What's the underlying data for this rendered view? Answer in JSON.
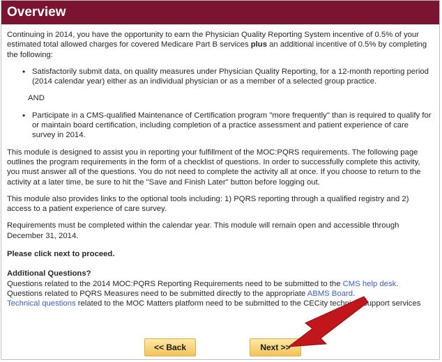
{
  "header": {
    "title": "Overview"
  },
  "content": {
    "intro_pre": "Continuing in 2014, you have the opportunity to earn the Physician Quality Reporting System incentive of 0.5% of your estimated total allowed charges for covered Medicare Part B services ",
    "intro_bold": "plus",
    "intro_post": " an additional incentive of 0.5% by completing the following:",
    "bullet1": "Satisfactorily submit data, on quality measures under Physician Quality Reporting, for a 12-month reporting period (2014 calendar year) either as an individual physician or as a member of a selected group practice.",
    "and_text": "AND",
    "bullet2": "Participate in a CMS-qualified Maintenance of Certification program \"more frequently\" than is required to qualify for or maintain board certification, including completion of a practice assessment and patient experience of care survey in 2014.",
    "para1": "This module is designed to assist you in reporting your fulfillment of the MOC:PQRS requirements. The following page outlines the program requirements in the form of a checklist of questions. In order to successfully complete this activity, you must answer all of the questions. You do not need to complete the activity all at once. If you choose to return to the activity at a later time, be sure to hit the \"Save and Finish Later\" button before logging out.",
    "para2": "This module also provides links to the optional tools including: 1) PQRS reporting through a qualified registry and 2) access to a patient experience of care survey.",
    "para3": "Requirements must be completed within the calendar year. This module will remain open and accessible through December 31, 2014.",
    "proceed": "Please click next  to proceed.",
    "aq_title": "Additional Questions?",
    "aq1_pre": "Questions related to the 2014 MOC:PQRS Reporting Requirements need to be submitted to the ",
    "aq1_link": "CMS help desk",
    "aq1_post": ".",
    "aq2_pre": "Questions related to PQRS Measures need to be submitted directly to the appropriate ",
    "aq2_link": "ABMS Board",
    "aq2_post": ".",
    "aq3_link": "Technical questions",
    "aq3_post": " related to the MOC Matters platform need to be submitted to the CECity technical support services"
  },
  "buttons": {
    "back_label": "<< Back",
    "next_label": "Next >>"
  },
  "colors": {
    "header_bg": "#7a1431",
    "link": "#3b5fc0",
    "button": "#f4c25a",
    "arrow": "#c0161c"
  }
}
